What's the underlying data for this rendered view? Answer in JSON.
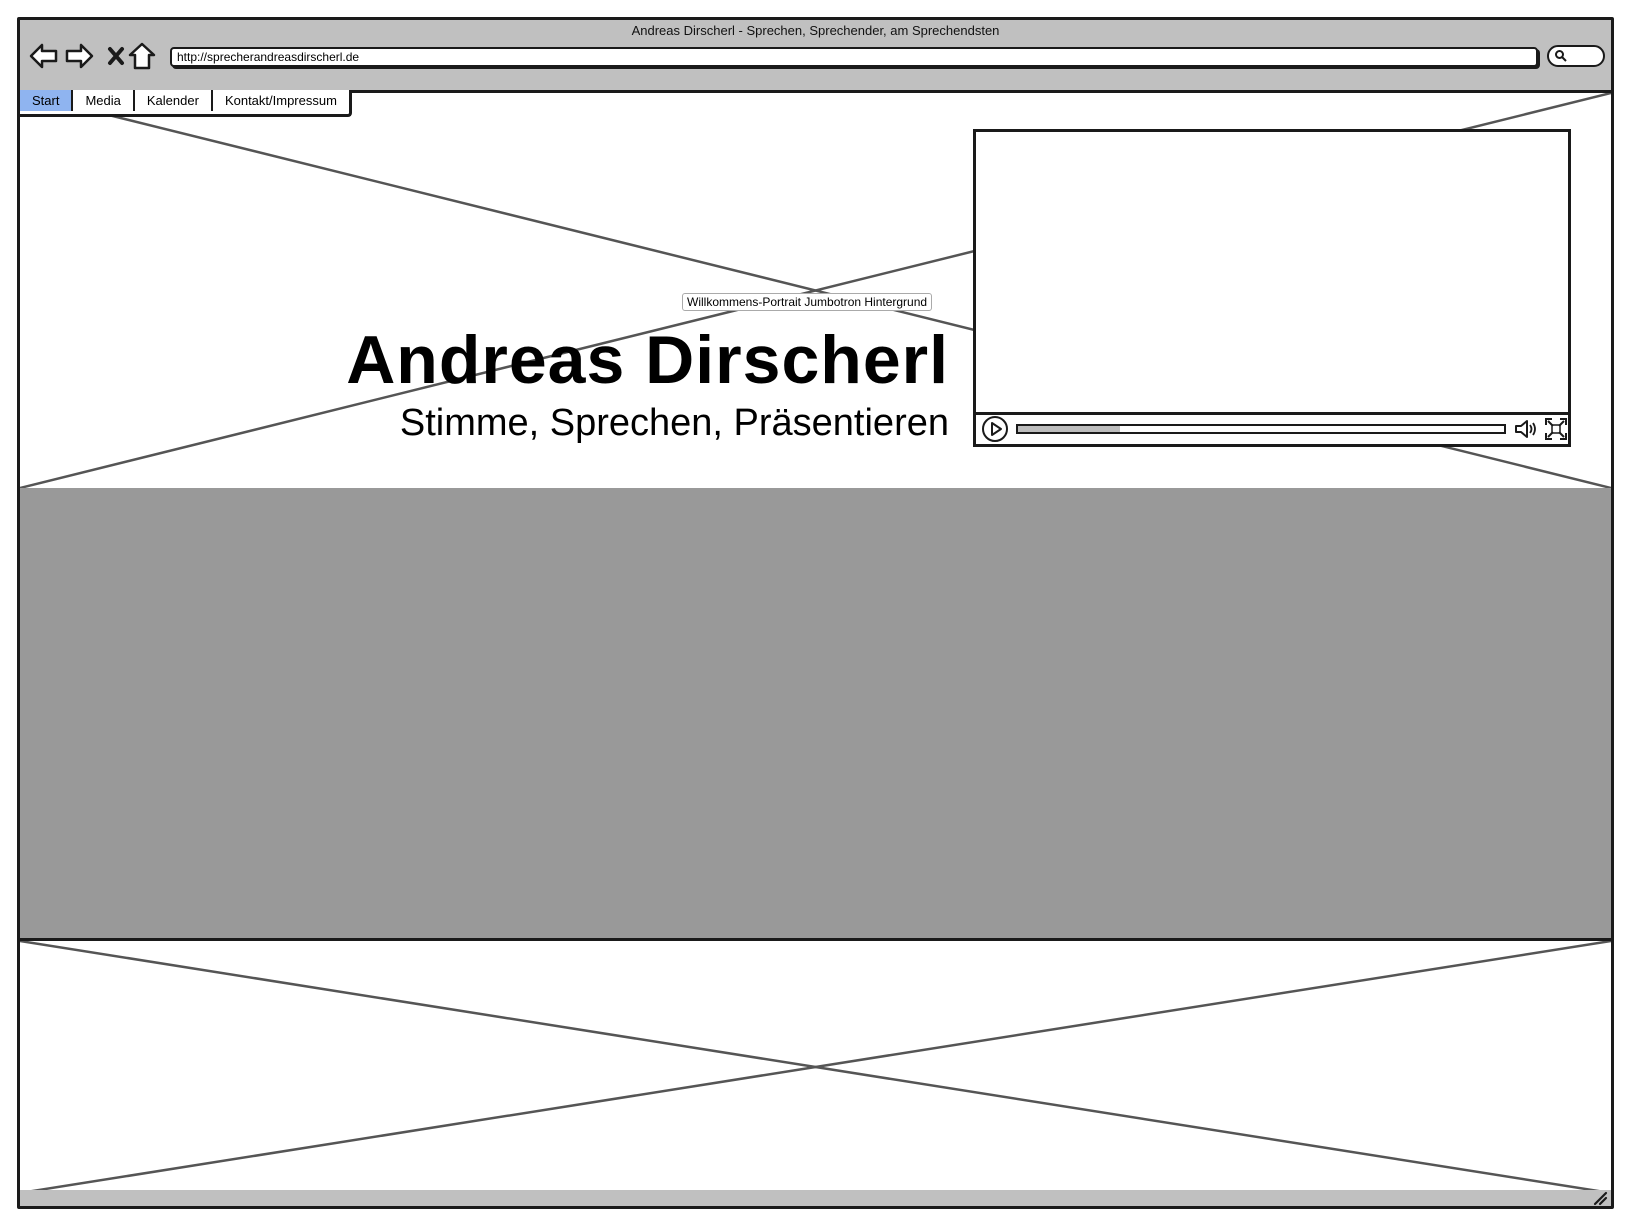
{
  "window": {
    "title": "Andreas Dirscherl - Sprechen, Sprechender, am Sprechendsten",
    "url": "http://sprecherandreasdirscherl.de"
  },
  "nav": {
    "tabs": [
      {
        "label": "Start",
        "active": true
      },
      {
        "label": "Media",
        "active": false
      },
      {
        "label": "Kalender",
        "active": false
      },
      {
        "label": "Kontakt/Impressum",
        "active": false
      }
    ]
  },
  "hero": {
    "caption": "Willkommens-Portrait Jumbotron Hintergrund",
    "title": "Andreas Dirscherl",
    "subtitle": "Stimme, Sprechen, Präsentieren"
  },
  "video": {
    "progress": 0.21
  },
  "colors": {
    "chrome": "#c0c0c0",
    "active_tab": "#8fb4f0",
    "gray_block": "#999999"
  },
  "icons": [
    "back-icon",
    "forward-icon",
    "stop-icon",
    "home-icon",
    "search-icon",
    "play-icon",
    "volume-icon",
    "fullscreen-icon",
    "resize-icon"
  ]
}
